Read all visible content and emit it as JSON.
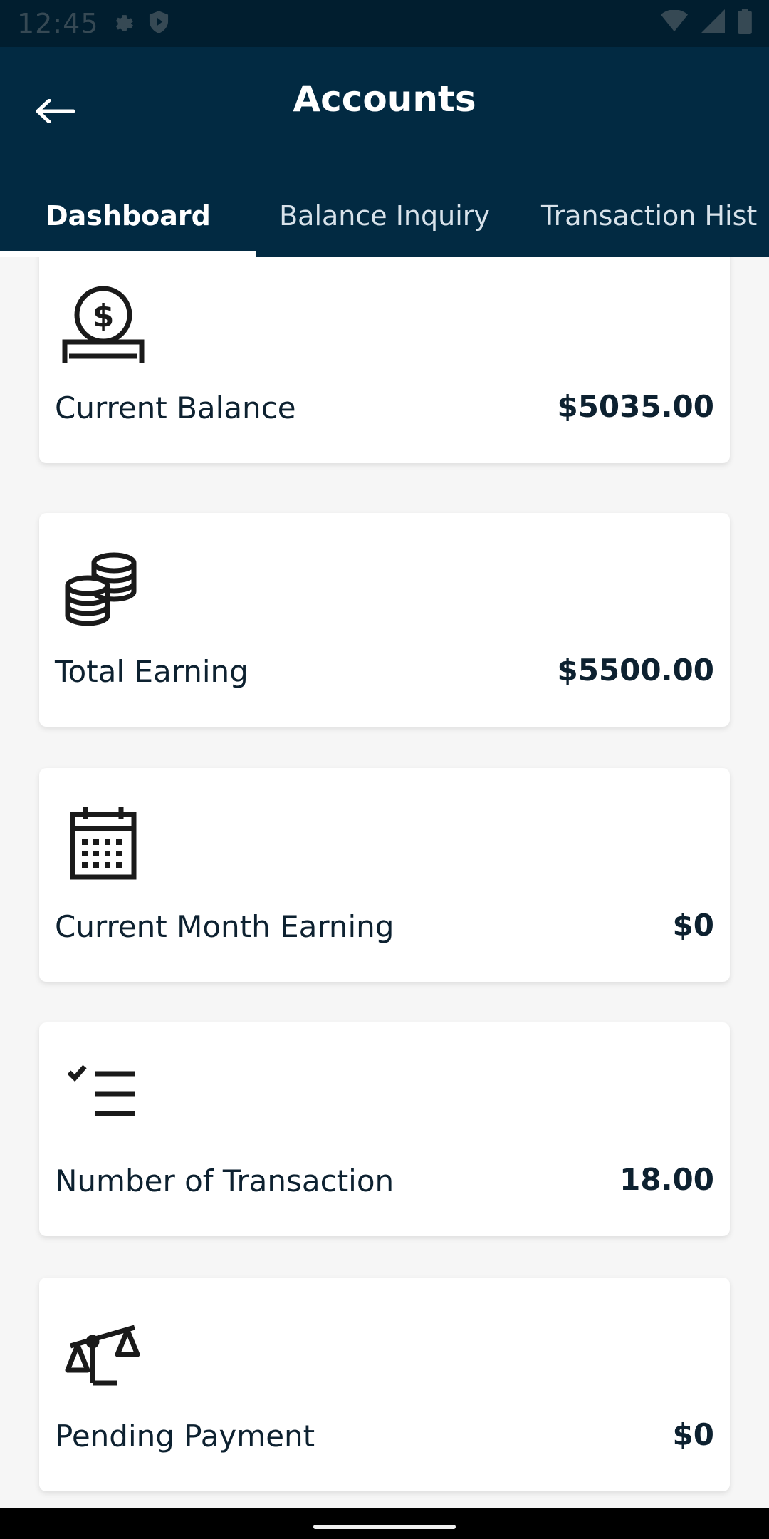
{
  "status_bar": {
    "time": "12:45",
    "icons": [
      "settings-icon",
      "shield-icon",
      "wifi-icon",
      "signal-icon",
      "battery-icon"
    ]
  },
  "app_bar": {
    "title": "Accounts",
    "back_icon": "arrow-left-icon"
  },
  "tabs": [
    {
      "label": "Dashboard",
      "active": true
    },
    {
      "label": "Balance Inquiry",
      "active": false
    },
    {
      "label": "Transaction Hist",
      "active": false
    }
  ],
  "cards": [
    {
      "icon": "money-hand-icon",
      "label": "Current Balance",
      "value": "$5035.00"
    },
    {
      "icon": "coins-stack-icon",
      "label": "Total Earning",
      "value": "$5500.00"
    },
    {
      "icon": "calendar-icon",
      "label": "Current Month Earning",
      "value": "$0"
    },
    {
      "icon": "checklist-icon",
      "label": "Number of Transaction",
      "value": "18.00"
    },
    {
      "icon": "scales-icon",
      "label": "Pending Payment",
      "value": "$0"
    }
  ],
  "colors": {
    "app_bar": "#022a42",
    "status_bar": "#011e2f",
    "background": "#f6f6f6",
    "card": "#ffffff",
    "text_dark": "#0d2130"
  }
}
